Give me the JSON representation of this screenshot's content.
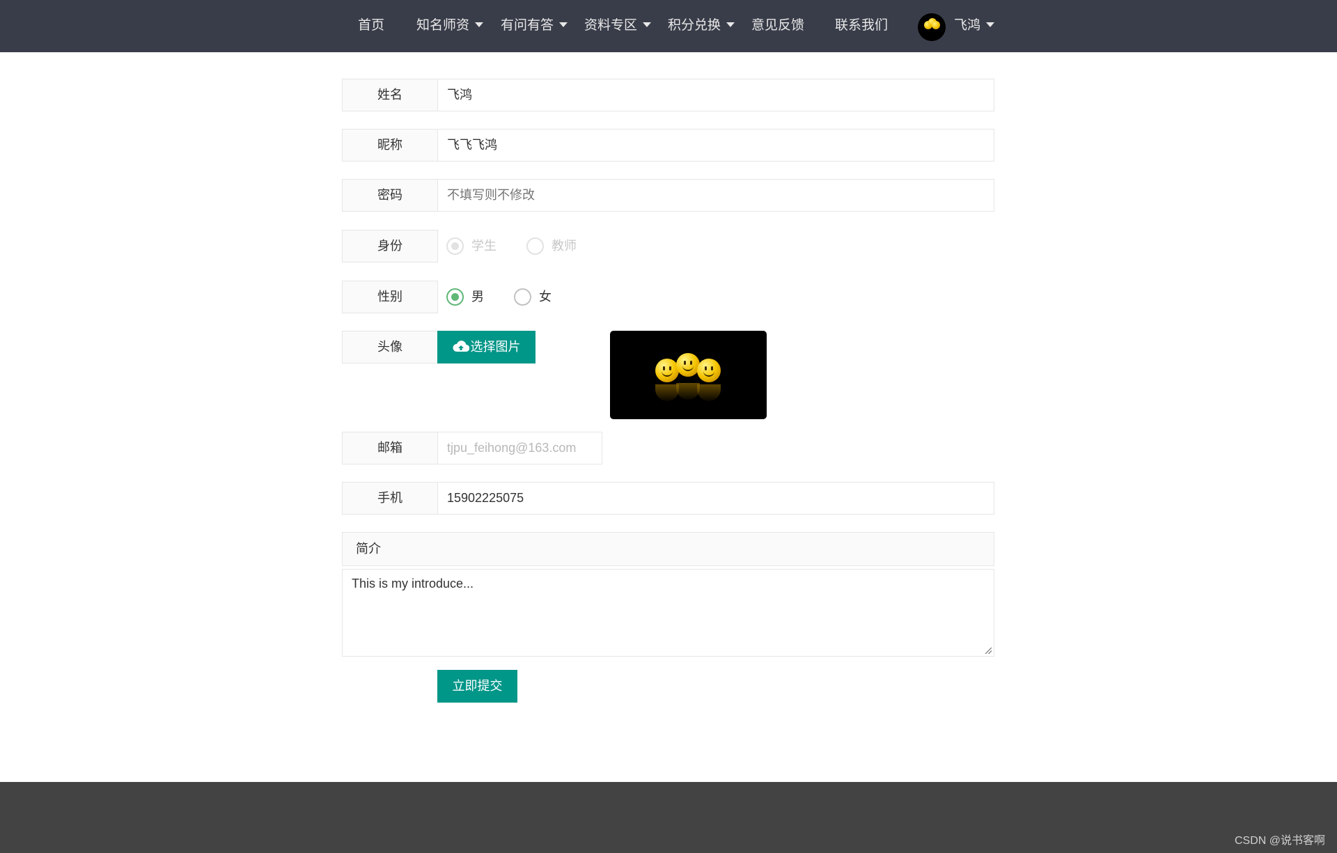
{
  "nav": {
    "items": [
      {
        "label": "首页",
        "dropdown": false
      },
      {
        "label": "知名师资",
        "dropdown": true
      },
      {
        "label": "有问有答",
        "dropdown": true
      },
      {
        "label": "资料专区",
        "dropdown": true
      },
      {
        "label": "积分兑换",
        "dropdown": true
      },
      {
        "label": "意见反馈",
        "dropdown": false
      },
      {
        "label": "联系我们",
        "dropdown": false
      }
    ],
    "user": {
      "name": "飞鸿",
      "avatar_icon": "smiley-avatar-icon"
    }
  },
  "form": {
    "name": {
      "label": "姓名",
      "value": "飞鸿"
    },
    "nickname": {
      "label": "昵称",
      "value": "飞飞飞鸿"
    },
    "password": {
      "label": "密码",
      "placeholder": "不填写则不修改"
    },
    "identity": {
      "label": "身份",
      "options": [
        "学生",
        "教师"
      ],
      "selected": "学生",
      "disabled": true
    },
    "gender": {
      "label": "性别",
      "options": [
        "男",
        "女"
      ],
      "selected": "男"
    },
    "avatar": {
      "label": "头像",
      "button_label": "选择图片",
      "button_icon": "cloud-upload-icon"
    },
    "email": {
      "label": "邮箱",
      "value": "tjpu_feihong@163.com"
    },
    "phone": {
      "label": "手机",
      "value": "15902225075"
    },
    "intro": {
      "label": "简介",
      "value": "This is my introduce..."
    },
    "submit_label": "立即提交"
  },
  "footer": {
    "credit": "CSDN @说书客啊"
  },
  "colors": {
    "nav_bg": "#393d49",
    "primary": "#009688",
    "radio_on": "#5fb878",
    "footer_bg": "#434343"
  }
}
